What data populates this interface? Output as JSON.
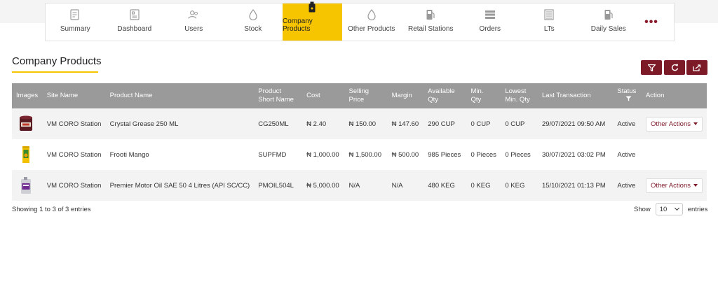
{
  "nav": {
    "items": [
      {
        "label": "Summary",
        "icon": "summary-icon"
      },
      {
        "label": "Dashboard",
        "icon": "dashboard-icon"
      },
      {
        "label": "Users",
        "icon": "users-icon"
      },
      {
        "label": "Stock",
        "icon": "stock-drop-icon"
      },
      {
        "label": "Company Products",
        "icon": "company-products-icon",
        "active": true
      },
      {
        "label": "Other Products",
        "icon": "other-products-drop-icon"
      },
      {
        "label": "Retail Stations",
        "icon": "fuel-pump-icon"
      },
      {
        "label": "Orders",
        "icon": "orders-icon"
      },
      {
        "label": "LTs",
        "icon": "lts-icon"
      },
      {
        "label": "Daily Sales",
        "icon": "fuel-pump-icon"
      }
    ],
    "more_label": "•••"
  },
  "page": {
    "title": "Company Products"
  },
  "toolbar": {
    "filter_icon": "filter-icon",
    "refresh_icon": "refresh-icon",
    "export_icon": "export-icon"
  },
  "table": {
    "headers": {
      "images": "Images",
      "site_name": "Site Name",
      "product_name": "Product Name",
      "short_name_1": "Product",
      "short_name_2": "Short Name",
      "cost": "Cost",
      "selling_1": "Selling",
      "selling_2": "Price",
      "margin": "Margin",
      "avail_1": "Available",
      "avail_2": "Qty",
      "min_1": "Min.",
      "min_2": "Qty",
      "lowest_1": "Lowest",
      "lowest_2": "Min. Qty",
      "last_txn": "Last Transaction",
      "status": "Status",
      "action": "Action"
    },
    "rows": [
      {
        "site": "VM CORO Station",
        "product": "Crystal Grease 250 ML",
        "short": "CG250ML",
        "cost": "₦ 2.40",
        "selling": "₦ 150.00",
        "margin": "₦ 147.60",
        "available": "290 CUP",
        "min": "0 CUP",
        "lowest": "0 CUP",
        "last": "29/07/2021 09:50 AM",
        "status": "Active",
        "action": "Other Actions"
      },
      {
        "site": "VM CORO Station",
        "product": "Frooti Mango",
        "short": "SUPFMD",
        "cost": "₦ 1,000.00",
        "selling": "₦ 1,500.00",
        "margin": "₦ 500.00",
        "available": "985 Pieces",
        "min": "0 Pieces",
        "lowest": "0 Pieces",
        "last": "30/07/2021 03:02 PM",
        "status": "Active",
        "action": ""
      },
      {
        "site": "VM CORO Station",
        "product": "Premier Motor Oil SAE 50 4 Litres (API SC/CC)",
        "short": "PMOIL504L",
        "cost": "₦ 5,000.00",
        "selling": "N/A",
        "margin": "N/A",
        "available": "480 KEG",
        "min": "0 KEG",
        "lowest": "0 KEG",
        "last": "15/10/2021 01:13 PM",
        "status": "Active",
        "action": "Other Actions"
      }
    ]
  },
  "footer": {
    "info": "Showing 1 to 3 of 3 entries",
    "show_label": "Show",
    "page_size": "10",
    "entries_label": "entries"
  },
  "colors": {
    "accent_yellow": "#f7c500",
    "brand_maroon": "#7d1a28",
    "header_gray": "#9a9a9a"
  }
}
